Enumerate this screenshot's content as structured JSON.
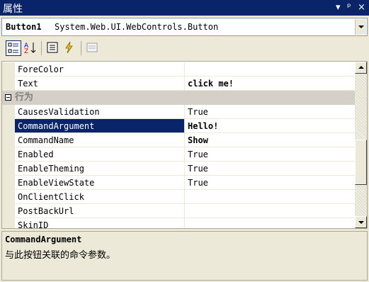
{
  "window": {
    "title": "属性",
    "controls": [
      "▾",
      "ᵖ",
      "×"
    ]
  },
  "object_selector": {
    "name": "Button1",
    "type": "System.Web.UI.WebControls.Button"
  },
  "toolbar": {
    "buttons": [
      "categorized-icon",
      "alphabetical-icon",
      "properties-icon",
      "events-icon",
      "property-pages-icon"
    ],
    "active": "categorized-icon"
  },
  "grid": {
    "rows_before": [
      {
        "name": "ForeColor",
        "value": "",
        "bold": false
      },
      {
        "name": "Text",
        "value": "click me!",
        "bold": true
      }
    ],
    "category": {
      "label": "行为",
      "expanded": true
    },
    "rows_after": [
      {
        "name": "CausesValidation",
        "value": "True",
        "bold": false
      },
      {
        "name": "CommandArgument",
        "value": "Hello!",
        "bold": true,
        "selected": true
      },
      {
        "name": "CommandName",
        "value": "Show",
        "bold": true
      },
      {
        "name": "Enabled",
        "value": "True",
        "bold": false
      },
      {
        "name": "EnableTheming",
        "value": "True",
        "bold": false
      },
      {
        "name": "EnableViewState",
        "value": "True",
        "bold": false
      },
      {
        "name": "OnClientClick",
        "value": "",
        "bold": false
      },
      {
        "name": "PostBackUrl",
        "value": "",
        "bold": false
      },
      {
        "name": "SkinID",
        "value": "",
        "bold": false
      }
    ]
  },
  "description": {
    "title": "CommandArgument",
    "text": "与此按钮关联的命令参数。"
  },
  "colors": {
    "selection": "#0a246a",
    "panel": "#ece9d8",
    "category": "#d4d0c8"
  }
}
